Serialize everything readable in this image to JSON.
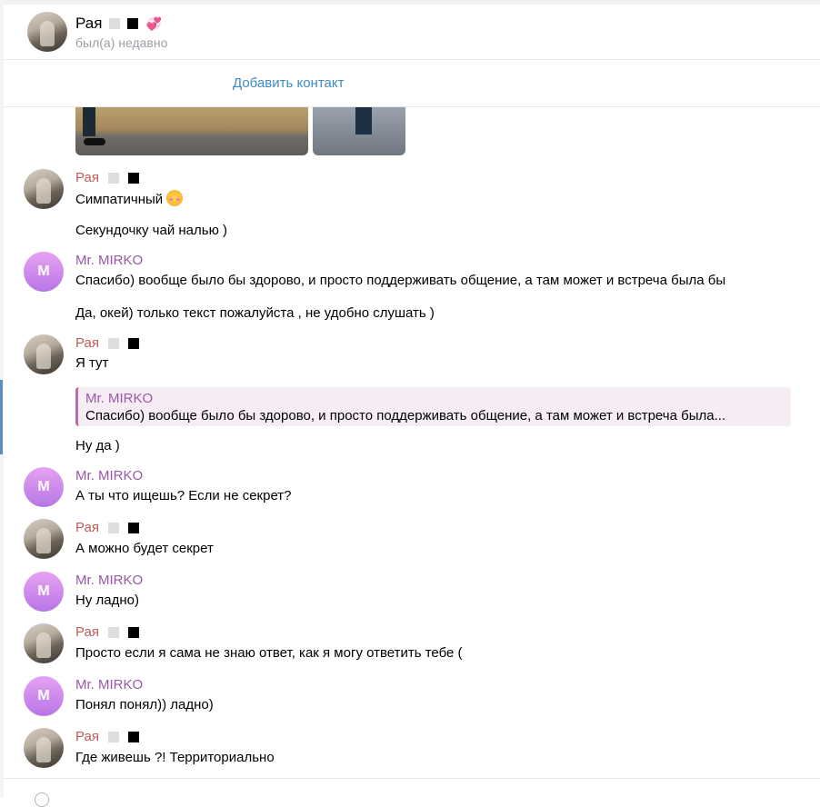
{
  "header": {
    "name": "Рая",
    "status": "был(а) недавно"
  },
  "add_contact": "Добавить контакт",
  "colors": {
    "link": "#3f8ac5",
    "raya_name": "#bd5c58",
    "mirko_name": "#9a58a8",
    "mirko_avatar": "#c382ee",
    "quote_bg": "#f6ecf3"
  },
  "icons": [
    "square-gray-icon",
    "square-black-icon",
    "heart-icon",
    "blush-emoji-icon"
  ],
  "messages": [
    {
      "sender": "Рая",
      "lines": [
        "Симпатичный",
        "Секундочку чай налью )"
      ]
    },
    {
      "sender": "Mr. MIRKO",
      "avatar_letter": "M",
      "lines": [
        "Спасибо) вообще было бы здорово, и просто поддерживать общение, а там может и встреча была бы",
        "Да, окей) только текст пожалуйста , не удобно слушать )"
      ]
    },
    {
      "sender": "Рая",
      "lines": [
        "Я тут"
      ],
      "reply": {
        "name": "Mr. MIRKO",
        "text": "Спасибо) вообще было бы здорово, и просто поддерживать общение, а там может и встреча была..."
      },
      "after_reply": "Ну да )"
    },
    {
      "sender": "Mr. MIRKO",
      "avatar_letter": "M",
      "lines": [
        "А ты что ищешь? Если не секрет?"
      ]
    },
    {
      "sender": "Рая",
      "lines": [
        "А можно будет секрет"
      ]
    },
    {
      "sender": "Mr. MIRKO",
      "avatar_letter": "M",
      "lines": [
        "Ну ладно)"
      ]
    },
    {
      "sender": "Рая",
      "lines": [
        "Просто если я сама не знаю ответ, как я могу ответить тебе ("
      ]
    },
    {
      "sender": "Mr. MIRKO",
      "avatar_letter": "M",
      "lines": [
        "Понял понял)) ладно)"
      ]
    },
    {
      "sender": "Рая",
      "lines": [
        "Где живешь ?! Территориально"
      ]
    }
  ]
}
